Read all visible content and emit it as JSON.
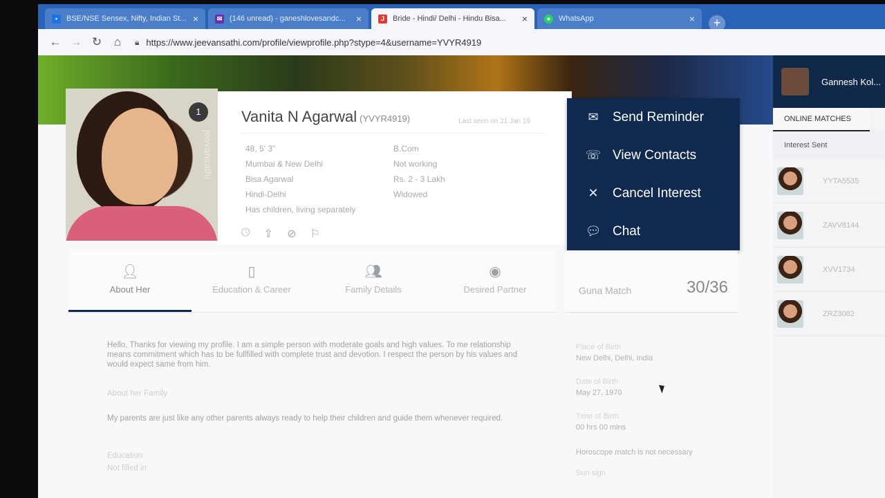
{
  "browser": {
    "tabs": [
      {
        "title": "BSE/NSE Sensex, Nifty, Indian St...",
        "icon": "market-icon",
        "color": "#1a73e8"
      },
      {
        "title": "(146 unread) - ganeshlovesandc...",
        "icon": "mail-icon",
        "color": "#6b2fb3"
      },
      {
        "title": "Bride - Hindi/ Delhi - Hindu Bisa...",
        "icon": "jeevansathi-icon",
        "color": "#e53935"
      },
      {
        "title": "WhatsApp",
        "icon": "whatsapp-icon",
        "color": "#25d366"
      }
    ],
    "url": "https://www.jeevansathi.com/profile/viewprofile.php?stype=4&username=YVYR4919"
  },
  "profile": {
    "name": "Vanita N Agarwal",
    "username": "(YVYR4919)",
    "last_seen": "Last seen on 21 Jan 19",
    "photo_count": "1",
    "watermark": "jeevansathi",
    "details_left": [
      "48, 5' 3\"",
      "Mumbai & New Delhi",
      "Bisa Agarwal",
      "Hindi-Delhi",
      "Has children, living separately"
    ],
    "details_right": [
      "B.Com",
      "Not working",
      "Rs. 2 - 3 Lakh",
      "Widowed"
    ]
  },
  "actions": [
    {
      "label": "Send Reminder",
      "icon": "envelope-icon"
    },
    {
      "label": "View Contacts",
      "icon": "phone-icon"
    },
    {
      "label": "Cancel Interest",
      "icon": "close-icon"
    },
    {
      "label": "Chat",
      "icon": "chat-icon"
    }
  ],
  "profile_tabs": [
    {
      "label": "About Her",
      "icon": "person-icon"
    },
    {
      "label": "Education & Career",
      "icon": "document-icon"
    },
    {
      "label": "Family Details",
      "icon": "family-icon"
    },
    {
      "label": "Desired Partner",
      "icon": "eye-icon"
    }
  ],
  "guna": {
    "label": "Guna Match",
    "value": "30/36"
  },
  "about": {
    "intro": "Hello, Thanks for viewing my profile. I am a simple person with moderate goals and high values. To me relationship means commitment which has to be fullfilled with complete trust and devotion. I respect the person by his values and would expect same from him.",
    "family_heading": "About her Family",
    "family_text": "My parents are just like any other parents always ready to help their children and guide them whenever required.",
    "education_heading": "Education",
    "education_text": "Not filled in"
  },
  "birth": [
    {
      "key": "Place of Birth",
      "value": "New Delhi, Delhi, India"
    },
    {
      "key": "Date of Birth",
      "value": "May 27, 1970"
    },
    {
      "key": "Time of Birth",
      "value": "00 hrs 00 mins"
    },
    {
      "key": "",
      "value": "Horoscope match is not necessary"
    },
    {
      "key": "Sun sign",
      "value": ""
    }
  ],
  "sidebar": {
    "user": "Gannesh Kol...",
    "tab": "ONLINE MATCHES",
    "subheading": "Interest Sent",
    "matches": [
      "YYTA5535",
      "ZAVV8144",
      "XVV1734",
      "ZRZ3082"
    ]
  }
}
